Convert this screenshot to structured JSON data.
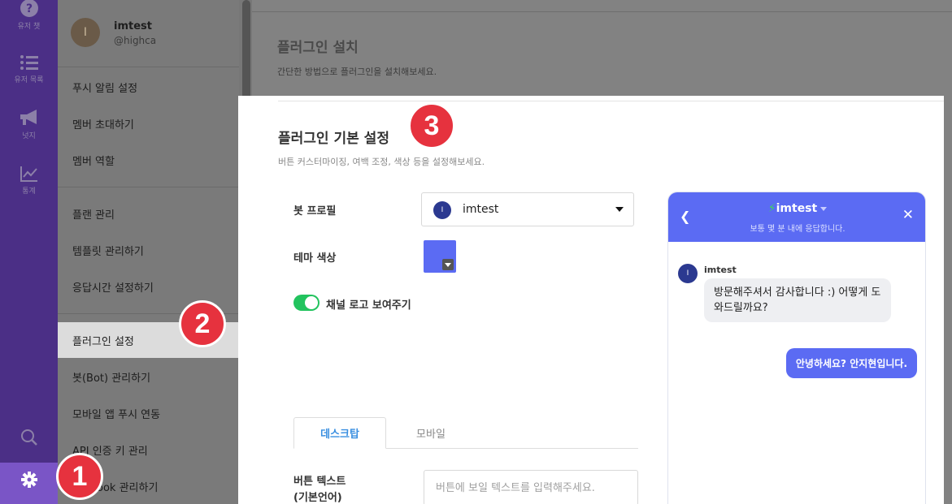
{
  "rail": {
    "items": [
      {
        "icon": "help-icon",
        "label": "유저 챗"
      },
      {
        "icon": "list-icon",
        "label": "유저 목록"
      },
      {
        "icon": "megaphone-icon",
        "label": "넛지"
      },
      {
        "icon": "chart-icon",
        "label": "통계"
      }
    ],
    "search_icon": "search-icon",
    "settings_icon": "gear-icon"
  },
  "profile": {
    "initial": "I",
    "name": "imtest",
    "handle": "@highca"
  },
  "menu": [
    "푸시 알림 설정",
    "멤버 초대하기",
    "멤버 역할",
    "플랜 관리",
    "템플릿 관리하기",
    "응답시간 설정하기",
    "플러그인 설정",
    "봇(Bot) 관리하기",
    "모바일 앱 푸시 연동",
    "API 인증 키 관리",
    "ook 관리하기"
  ],
  "background_header": {
    "title": "플러그인 설치",
    "subtitle": "간단한 방법으로 플러그인을 설치해보세요."
  },
  "panel": {
    "title": "플러그인 기본 설정",
    "subtitle": "버튼 커스터마이징, 여백 조정, 색상 등을 설정해보세요.",
    "bot_profile_label": "봇 프로필",
    "bot_profile_initial": "I",
    "bot_profile_value": "imtest",
    "theme_color_label": "테마 색상",
    "theme_color": "#5b6bf3",
    "toggle_label": "채널 로고 보여주기",
    "toggle_on": true,
    "tabs": [
      "데스크탑",
      "모바일"
    ],
    "button_text_label_line1": "버튼 텍스트",
    "button_text_label_line2": "(기본언어)",
    "button_text_placeholder": "버튼에 보일 텍스트를 입력해주세요."
  },
  "chat_preview": {
    "title": "imtest",
    "subtitle": "보통 몇 분 내에 응답합니다.",
    "bot_initial": "I",
    "bot_name": "imtest",
    "bot_message": "방문해주셔서 감사합니다 :) 어떻게 도와드릴까요?",
    "user_message": "안녕하세요? 안지현입니다."
  },
  "badges": [
    "1",
    "2",
    "3"
  ]
}
